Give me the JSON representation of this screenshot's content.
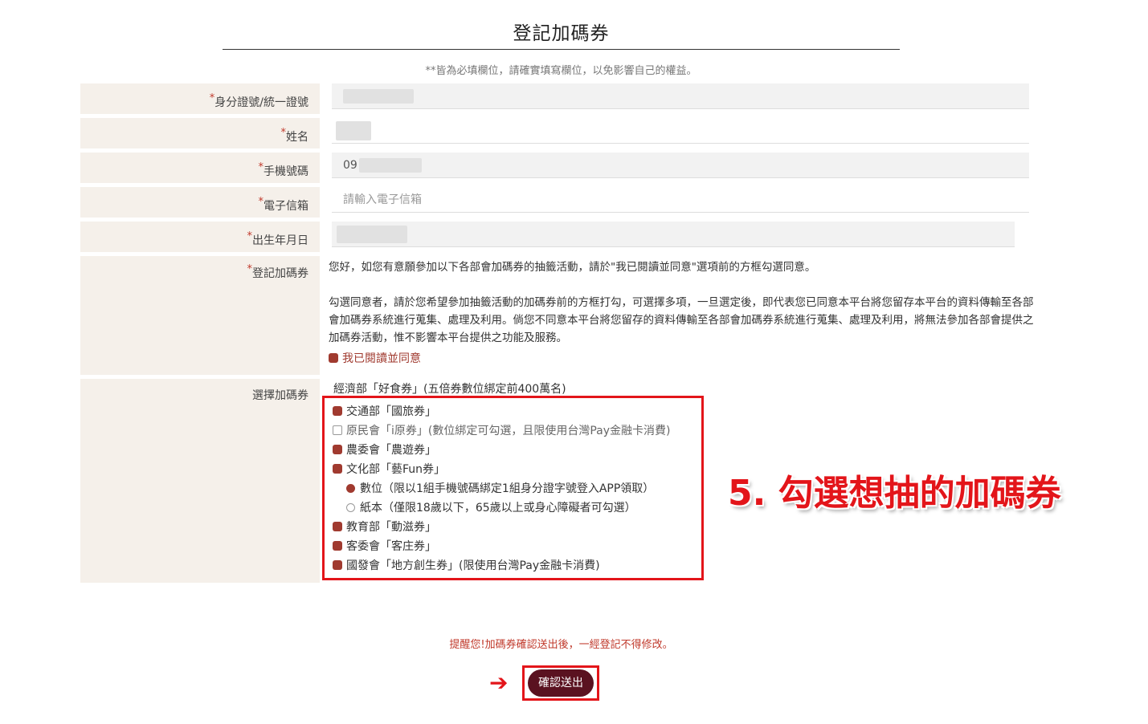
{
  "page": {
    "title": "登記加碼券",
    "notice": "**皆為必填欄位，請確實填寫欄位，以免影響自己的權益。"
  },
  "form": {
    "required_mark": "*",
    "id_label": "身分證號/統一證號",
    "name_label": "姓名",
    "phone_label": "手機號碼",
    "phone_prefix": "09",
    "email_label": "電子信箱",
    "email_placeholder": "請輸入電子信箱",
    "birth_label": "出生年月日",
    "register_label": "登記加碼券",
    "choose_label": "選擇加碼券"
  },
  "consent": {
    "para1": "您好，如您有意願參加以下各部會加碼券的抽籤活動，請於\"我已閱讀並同意\"選項前的方框勾選同意。",
    "para2": "勾選同意者，請於您希望參加抽籤活動的加碼券前的方框打勾，可選擇多項，一旦選定後，即代表您已同意本平台將您留存本平台的資料傳輸至各部會加碼券系統進行蒐集、處理及利用。倘您不同意本平台將您留存的資料傳輸至各部會加碼券系統進行蒐集、處理及利用，將無法參加各部會提供之加碼券活動，惟不影響本平台提供之功能及服務。",
    "agree_label": "我已閱讀並同意"
  },
  "vouchers": {
    "header": "經濟部「好食券」(五倍券數位綁定前400萬名)",
    "items": [
      "交通部「國旅券」",
      "原民會「i原券」(數位綁定可勾選，且限使用台灣Pay金融卡消費)",
      "農委會「農遊券」",
      "文化部「藝Fun券」",
      "數位（限以1組手機號碼綁定1組身分證字號登入APP領取）",
      "紙本（僅限18歲以下，65歲以上或身心障礙者可勾選）",
      "教育部「動滋券」",
      "客委會「客庄券」",
      "國發會「地方創生券」(限使用台灣Pay金融卡消費)"
    ]
  },
  "annotation": "5. 勾選想抽的加碼券",
  "footer": {
    "reminder": "提醒您!加碼券確認送出後，一經登記不得修改。",
    "arrow": "➔",
    "submit": "確認送出"
  },
  "colors": {
    "accent": "#a03a2f",
    "annotation_red": "#e3151a",
    "button": "#5a1220",
    "label_bg": "#f5f0ea"
  }
}
